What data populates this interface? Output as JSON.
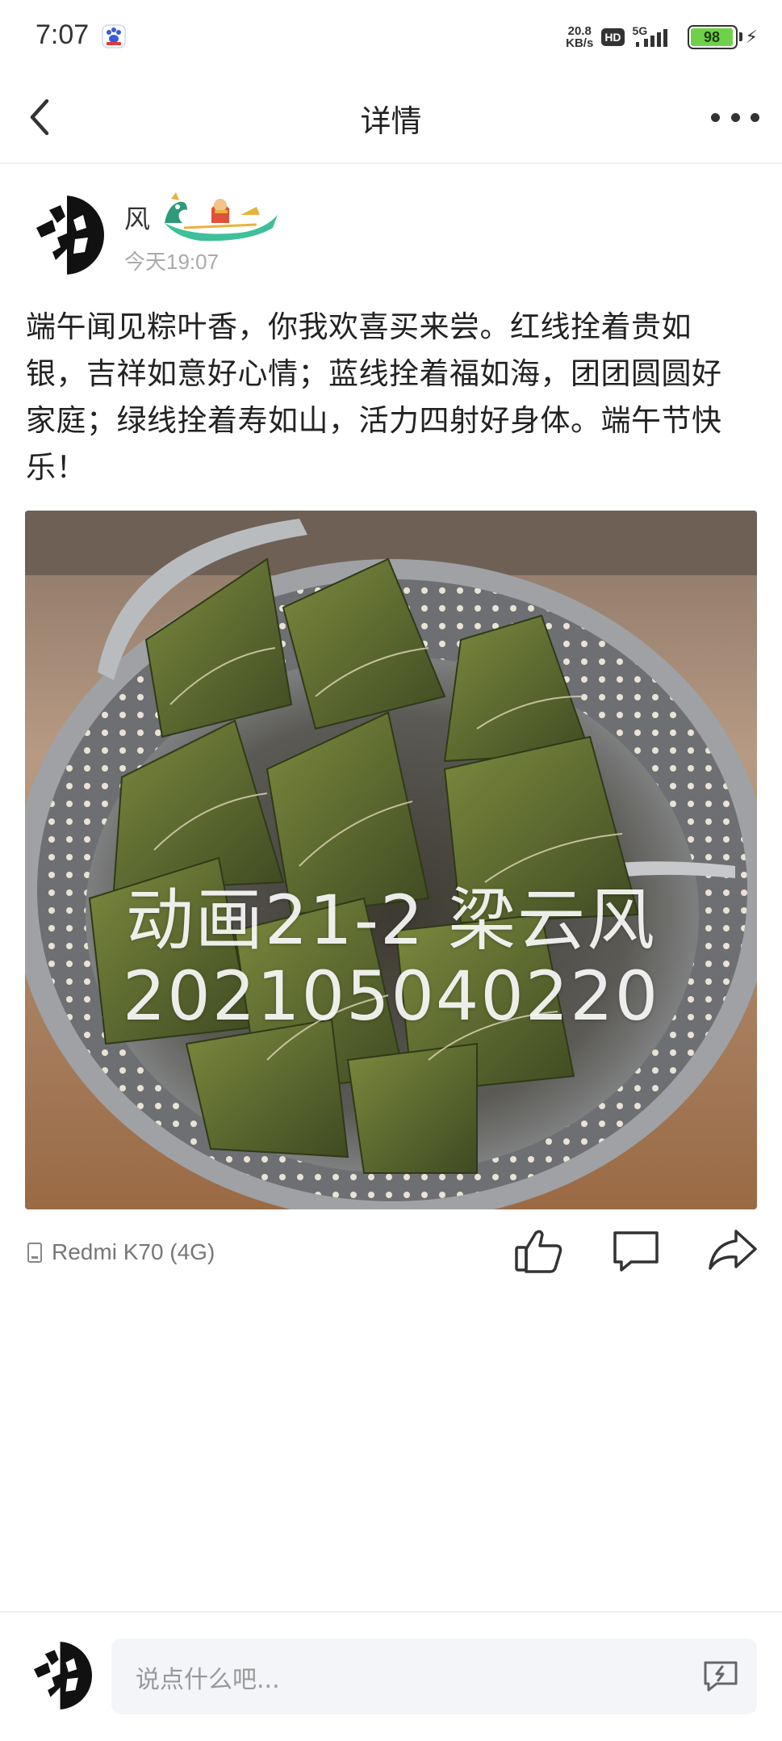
{
  "status_bar": {
    "time": "7:07",
    "net_speed_value": "20.8",
    "net_speed_unit": "KB/s",
    "hd": "HD",
    "network": "5G",
    "battery": "98",
    "battery_level_percent": 98,
    "battery_color": "#6fd14a"
  },
  "nav": {
    "title": "详情",
    "back_icon": "chevron-left-icon",
    "more_icon": "more-dots-icon"
  },
  "post": {
    "username": "风",
    "badge": "dragon-boat-badge",
    "time": "今天19:07",
    "text": "端午闻见粽叶香，你我欢喜买来尝。红线拴着贵如银，吉祥如意好心情；蓝线拴着福如海，团团圆圆好家庭；绿线拴着寿如山，活力四射好身体。端午节快乐！",
    "image_watermark_line1": "动画21-2 梁云风",
    "image_watermark_line2": "202105040220",
    "device": "Redmi K70 (4G)"
  },
  "actions": {
    "like_icon": "thumbs-up-icon",
    "comment_icon": "comment-icon",
    "share_icon": "share-icon"
  },
  "comment_bar": {
    "placeholder": "说点什么吧...",
    "emoji_icon": "sticker-icon"
  }
}
